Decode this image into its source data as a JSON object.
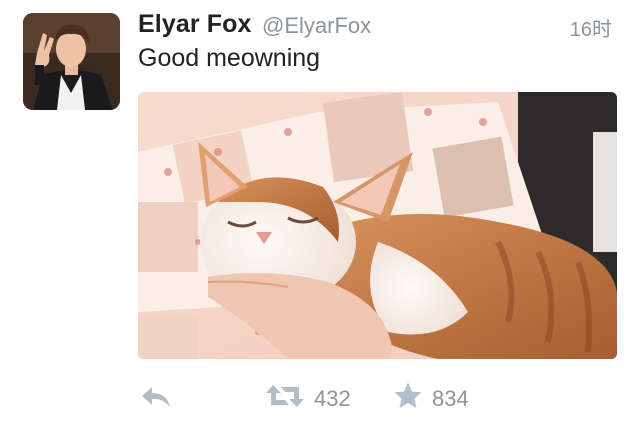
{
  "tweet": {
    "name": "Elyar Fox",
    "handle": "@ElyarFox",
    "time": "16时",
    "text": "Good meowning"
  },
  "actions": {
    "reply_icon": "reply-icon",
    "retweet_icon": "retweet-icon",
    "retweet_count": "432",
    "favorite_icon": "star-icon",
    "favorite_count": "834"
  },
  "colors": {
    "text": "#222222",
    "muted": "#8a959e",
    "icon": "#b3bfc8"
  }
}
